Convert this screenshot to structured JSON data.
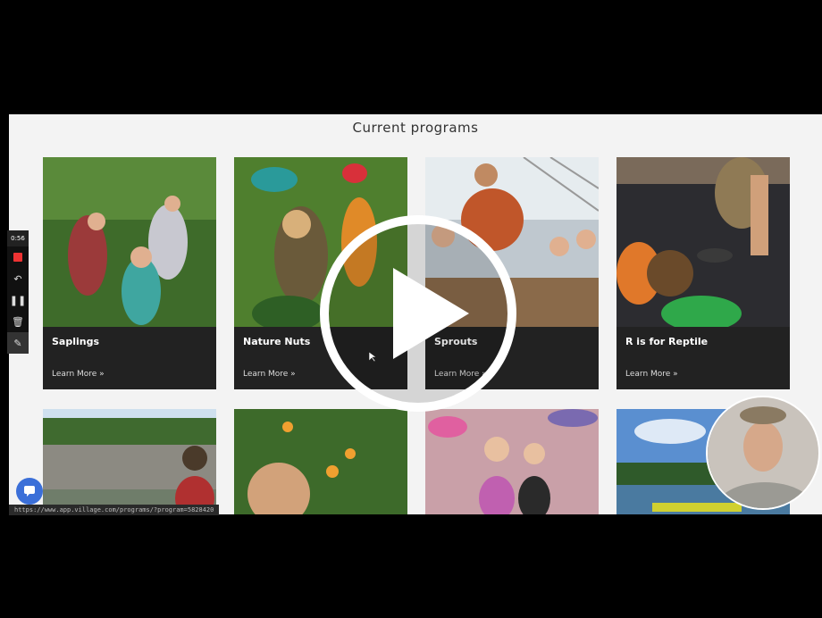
{
  "page": {
    "title": "Current programs"
  },
  "programs": [
    {
      "name": "Saplings",
      "link": "Learn More »"
    },
    {
      "name": "Nature Nuts",
      "link": "Learn More »"
    },
    {
      "name": "Sprouts",
      "link": "Learn More »"
    },
    {
      "name": "R is for Reptile",
      "link": "Learn More »"
    }
  ],
  "recorder": {
    "timer": "0:56"
  },
  "status_bar": {
    "url": "https://www.app.village.com/programs/?program=5828420"
  },
  "colors": {
    "card_bg": "#222222",
    "page_bg": "#f3f3f3",
    "chat_button": "#3b6fd8",
    "record": "#e33333"
  },
  "icons": [
    "play-icon",
    "record-icon",
    "undo-icon",
    "pause-icon",
    "trash-icon",
    "pen-icon",
    "chat-icon",
    "cursor-icon"
  ]
}
